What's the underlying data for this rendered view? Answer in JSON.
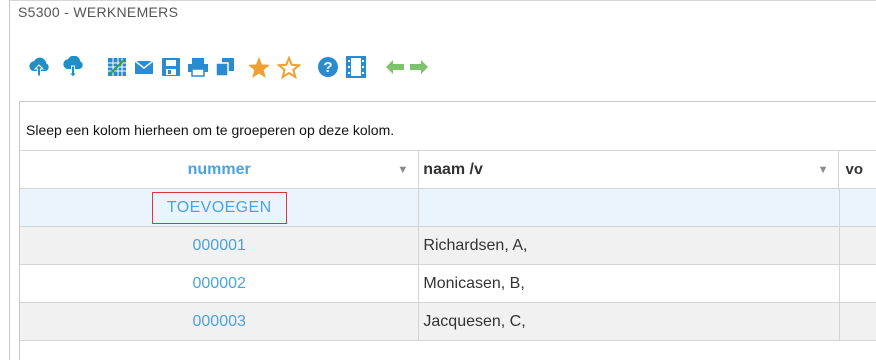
{
  "window": {
    "title": "S5300 - WERKNEMERS"
  },
  "toolbar": {
    "icons": [
      "upload-icon",
      "download-icon",
      "spreadsheet-icon",
      "mail-icon",
      "save-icon",
      "print-icon",
      "copy-icon",
      "star-filled-icon",
      "star-outline-icon",
      "help-icon",
      "film-icon",
      "arrow-left-icon",
      "arrow-right-icon"
    ]
  },
  "grid": {
    "group_hint": "Sleep een kolom hierheen om te groeperen op deze kolom.",
    "columns": [
      {
        "label": "nummer"
      },
      {
        "label": "naam /v"
      },
      {
        "label": "vo"
      }
    ],
    "add_label": "TOEVOEGEN",
    "rows": [
      {
        "nummer": "000001",
        "naam": "Richardsen, A,"
      },
      {
        "nummer": "000002",
        "naam": "Monicasen, B,"
      },
      {
        "nummer": "000003",
        "naam": "Jacquesen, C,"
      }
    ]
  },
  "colors": {
    "link": "#4ca3dc",
    "accent": "#f0a030",
    "nav": "#7dc36b",
    "highlight_border": "#d9383e"
  }
}
